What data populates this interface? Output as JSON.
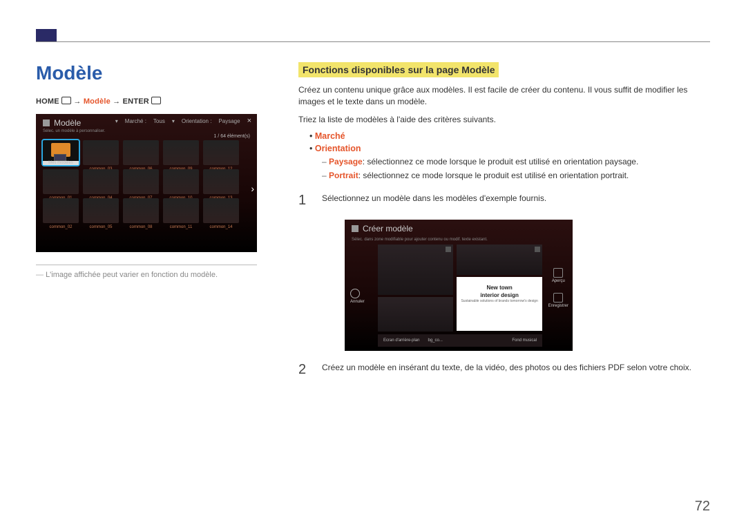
{
  "page_number": "72",
  "left": {
    "title": "Modèle",
    "breadcrumb": {
      "home": "HOME",
      "middle": "Modèle",
      "enter": "ENTER",
      "arrow": "→"
    },
    "screenshot": {
      "title": "Modèle",
      "subtitle": "Sélec. un modèle à personnaliser.",
      "filter_market_label": "Marché :",
      "filter_market_value": "Tous",
      "filter_orientation_label": "Orientation :",
      "filter_orientation_value": "Paysage",
      "count": "1 / 64 élément(s)",
      "first_cell": "Mes modèles",
      "cells_r1": [
        "common_03",
        "common_06",
        "common_09",
        "common_12"
      ],
      "cells_r2": [
        "common_01",
        "common_04",
        "common_07",
        "common_10",
        "common_13"
      ],
      "cells_r3": [
        "common_02",
        "common_05",
        "common_08",
        "common_11",
        "common_14"
      ]
    },
    "note": "L'image affichée peut varier en fonction du modèle."
  },
  "right": {
    "heading": "Fonctions disponibles sur la page Modèle",
    "intro": "Créez un contenu unique grâce aux modèles. Il est facile de créer du contenu. Il vous suffit de modifier les images et le texte dans un modèle.",
    "sort_intro": "Triez la liste de modèles à l'aide des critères suivants.",
    "bullets": {
      "market": "Marché",
      "orientation": "Orientation",
      "paysage_label": "Paysage",
      "paysage_text": ": sélectionnez ce mode lorsque le produit est utilisé en orientation paysage.",
      "portrait_label": "Portrait",
      "portrait_text": ": sélectionnez ce mode lorsque le produit est utilisé en orientation portrait."
    },
    "step1_num": "1",
    "step1_text": "Sélectionnez un modèle dans les modèles d'exemple fournis.",
    "screenshot2": {
      "title": "Créer modèle",
      "subtitle": "Sélec. dans zone modifiable pour ajouter contenu ou modif. texte existant.",
      "left_cancel": "Annuler",
      "right_preview": "Aperçu",
      "right_save": "Enregistrer",
      "card_line1": "New town",
      "card_line2": "interior design",
      "card_tiny": "Sustainable solutions of brands tomorrow's design",
      "bottom_bg": "Ecran d'arrière-plan",
      "bottom_bgco": "bg_co...",
      "bottom_music": "Fond musical"
    },
    "step2_num": "2",
    "step2_text": "Créez un modèle en insérant du texte, de la vidéo, des photos ou des fichiers PDF selon votre choix."
  }
}
